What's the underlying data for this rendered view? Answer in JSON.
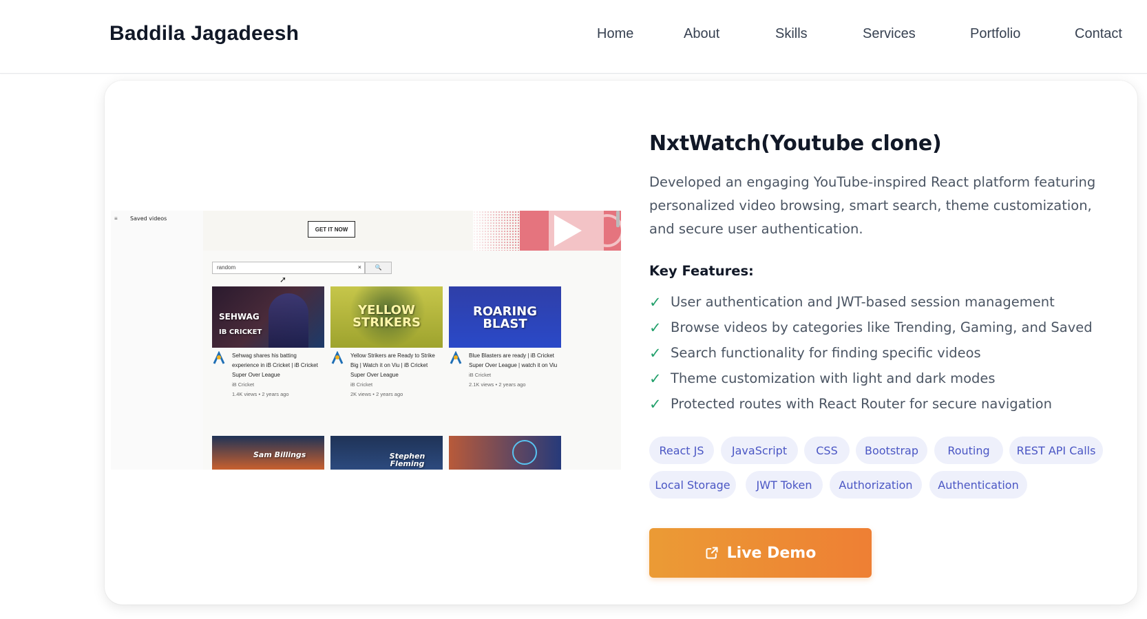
{
  "header": {
    "brand": "Baddila Jagadeesh",
    "nav": [
      "Home",
      "About",
      "Skills",
      "Services",
      "Portfolio",
      "Contact"
    ]
  },
  "project": {
    "title": "NxtWatch(Youtube clone)",
    "description": "Developed an engaging YouTube-inspired React platform featuring personalized video browsing, smart search, theme customization, and secure user authentication.",
    "features_title": "Key Features:",
    "features": [
      "User authentication and JWT-based session management",
      "Browse videos by categories like Trending, Gaming, and Saved",
      "Search functionality for finding specific videos",
      "Theme customization with light and dark modes",
      "Protected routes with React Router for secure navigation"
    ],
    "check_symbol": "✓",
    "tags": [
      "React JS",
      "JavaScript",
      "CSS",
      "Bootstrap",
      "Routing",
      "REST API Calls",
      "Local Storage",
      "JWT Token",
      "Authorization",
      "Authentication"
    ],
    "demo_label": "Live Demo"
  },
  "screenshot": {
    "sidebar_label": "Saved videos",
    "banner_button": "GET IT NOW",
    "search_value": "random",
    "search_clear": "×",
    "search_icon": "🔍",
    "videos": [
      {
        "thumb_text": "SEHWAG",
        "thumb_sub": "IB CRICKET",
        "title": "Sehwag shares his batting experience in iB Cricket | iB Cricket Super Over League",
        "channel": "iB Cricket",
        "views": "1.4K views",
        "age": "2 years ago"
      },
      {
        "thumb_text": "YELLOW STRIKERS",
        "title": "Yellow Strikers are Ready to Strike Big | Watch it on Viu | iB Cricket Super Over League",
        "channel": "iB Cricket",
        "views": "2K views",
        "age": "2 years ago"
      },
      {
        "thumb_text": "ROARING BLAST",
        "title": "Blue Blasters are ready | iB Cricket Super Over League | watch it on Viu",
        "channel": "iB Cricket",
        "views": "2.1K views",
        "age": "2 years ago"
      }
    ],
    "row2": [
      "Sam Billings",
      "Stephen Fleming",
      ""
    ]
  },
  "colors": {
    "accent_start": "#eb9b35",
    "accent_end": "#ee7f34",
    "check": "#22a06b",
    "tag_bg": "#eef0fb",
    "tag_text": "#4a56c4"
  }
}
